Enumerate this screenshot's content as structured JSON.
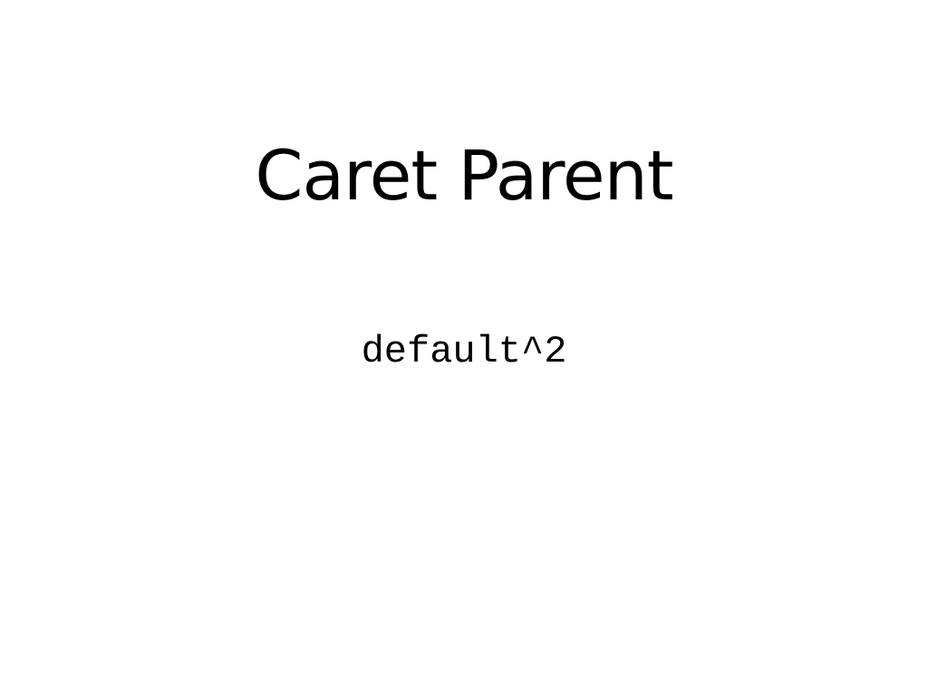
{
  "slide": {
    "title": "Caret Parent",
    "code": "default^2"
  }
}
